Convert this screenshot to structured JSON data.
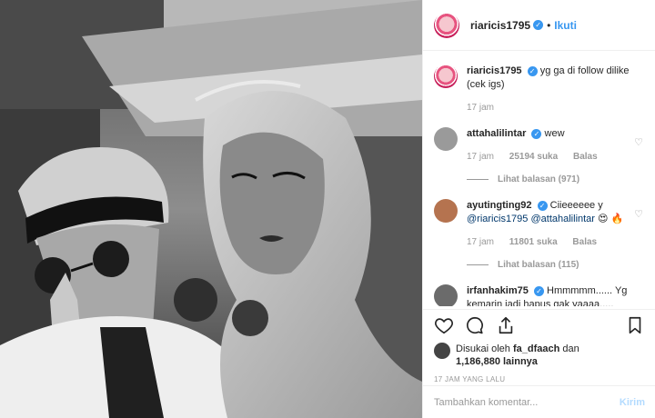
{
  "post": {
    "username": "riaricis1795",
    "follow_label": "Ikuti",
    "dot": "•",
    "caption": {
      "username": "riaricis1795",
      "text": "yg ga di follow dilike (cek igs)",
      "time": "17 jam"
    }
  },
  "comments": [
    {
      "username": "attahalilintar",
      "text": "wew",
      "time": "17 jam",
      "likes": "25194 suka",
      "reply_label": "Balas",
      "view_replies": "Lihat balasan (971)",
      "avatar_color": "#9a9a9a"
    },
    {
      "username": "ayutingting92",
      "text": "Ciieeeeee y",
      "mentions": [
        "@riaricis1795",
        "@attahalilintar"
      ],
      "emoji_1": "😍",
      "emoji_2": "🔥",
      "time": "17 jam",
      "likes": "11801 suka",
      "reply_label": "Balas",
      "view_replies": "Lihat balasan (115)",
      "avatar_color": "#b5734f"
    },
    {
      "username": "irfanhakim75",
      "text": "Hmmmmm...... Yg kemarin jadi hapus gak yaaaa.....",
      "avatar_color": "#6b6b6b"
    }
  ],
  "likes": {
    "prefix": "Disukai oleh",
    "user": "fa_dfaach",
    "conjunction": "dan",
    "count": "1,186,880",
    "suffix": "lainnya"
  },
  "post_time": "17 JAM YANG LALU",
  "add_comment": {
    "placeholder": "Tambahkan komentar...",
    "send_label": "Kirim"
  },
  "icons": [
    "heart-icon",
    "comment-icon",
    "share-icon",
    "bookmark-icon",
    "verified-icon"
  ],
  "colors": {
    "accent": "#3897f0",
    "verified": "#3897f0",
    "muted": "#999999",
    "mention": "#00376b"
  }
}
